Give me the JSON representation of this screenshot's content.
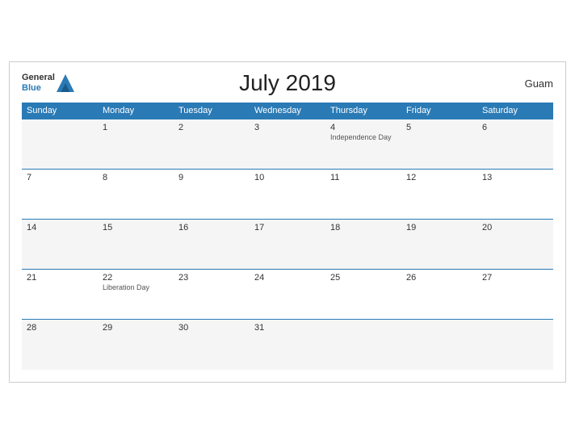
{
  "brand": {
    "general": "General",
    "blue": "Blue"
  },
  "title": "July 2019",
  "region": "Guam",
  "weekdays": [
    "Sunday",
    "Monday",
    "Tuesday",
    "Wednesday",
    "Thursday",
    "Friday",
    "Saturday"
  ],
  "weeks": [
    [
      {
        "day": "",
        "holiday": ""
      },
      {
        "day": "1",
        "holiday": ""
      },
      {
        "day": "2",
        "holiday": ""
      },
      {
        "day": "3",
        "holiday": ""
      },
      {
        "day": "4",
        "holiday": "Independence Day"
      },
      {
        "day": "5",
        "holiday": ""
      },
      {
        "day": "6",
        "holiday": ""
      }
    ],
    [
      {
        "day": "7",
        "holiday": ""
      },
      {
        "day": "8",
        "holiday": ""
      },
      {
        "day": "9",
        "holiday": ""
      },
      {
        "day": "10",
        "holiday": ""
      },
      {
        "day": "11",
        "holiday": ""
      },
      {
        "day": "12",
        "holiday": ""
      },
      {
        "day": "13",
        "holiday": ""
      }
    ],
    [
      {
        "day": "14",
        "holiday": ""
      },
      {
        "day": "15",
        "holiday": ""
      },
      {
        "day": "16",
        "holiday": ""
      },
      {
        "day": "17",
        "holiday": ""
      },
      {
        "day": "18",
        "holiday": ""
      },
      {
        "day": "19",
        "holiday": ""
      },
      {
        "day": "20",
        "holiday": ""
      }
    ],
    [
      {
        "day": "21",
        "holiday": ""
      },
      {
        "day": "22",
        "holiday": "Liberation Day"
      },
      {
        "day": "23",
        "holiday": ""
      },
      {
        "day": "24",
        "holiday": ""
      },
      {
        "day": "25",
        "holiday": ""
      },
      {
        "day": "26",
        "holiday": ""
      },
      {
        "day": "27",
        "holiday": ""
      }
    ],
    [
      {
        "day": "28",
        "holiday": ""
      },
      {
        "day": "29",
        "holiday": ""
      },
      {
        "day": "30",
        "holiday": ""
      },
      {
        "day": "31",
        "holiday": ""
      },
      {
        "day": "",
        "holiday": ""
      },
      {
        "day": "",
        "holiday": ""
      },
      {
        "day": "",
        "holiday": ""
      }
    ]
  ]
}
